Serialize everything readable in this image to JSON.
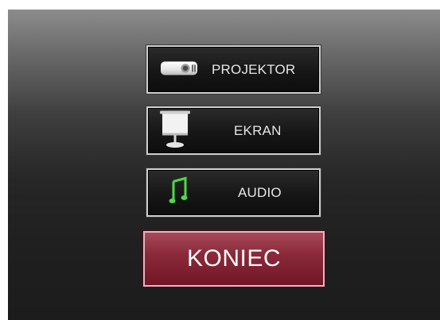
{
  "menu": {
    "projector": {
      "label": "PROJEKTOR",
      "icon": "projector-icon"
    },
    "screen": {
      "label": "EKRAN",
      "icon": "projection-screen-icon"
    },
    "audio": {
      "label": "AUDIO",
      "icon": "music-note-icon"
    }
  },
  "exit": {
    "label": "KONIEC"
  },
  "colors": {
    "exit_button": "#8b2a3a",
    "button_text": "#e6e6e6",
    "audio_icon": "#4fd84a"
  }
}
